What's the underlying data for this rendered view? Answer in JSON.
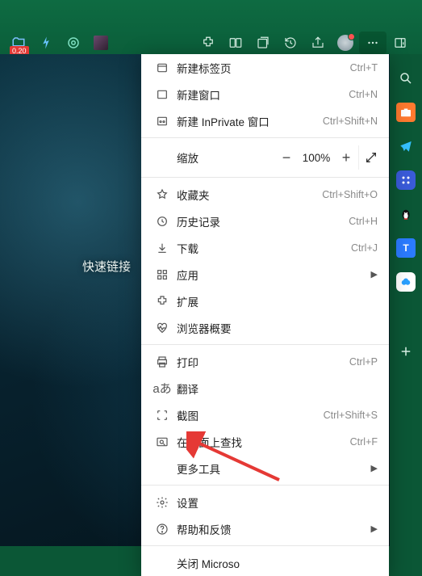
{
  "toolbar": {
    "badge": "0.20"
  },
  "content": {
    "quick_links": "快速链接"
  },
  "menu": {
    "new_tab": {
      "label": "新建标签页",
      "shortcut": "Ctrl+T"
    },
    "new_window": {
      "label": "新建窗口",
      "shortcut": "Ctrl+N"
    },
    "new_inprivate": {
      "label": "新建 InPrivate 窗口",
      "shortcut": "Ctrl+Shift+N"
    },
    "zoom": {
      "label": "缩放",
      "percent": "100%"
    },
    "favorites": {
      "label": "收藏夹",
      "shortcut": "Ctrl+Shift+O"
    },
    "history": {
      "label": "历史记录",
      "shortcut": "Ctrl+H"
    },
    "downloads": {
      "label": "下载",
      "shortcut": "Ctrl+J"
    },
    "apps": {
      "label": "应用"
    },
    "extensions": {
      "label": "扩展"
    },
    "browser_essentials": {
      "label": "浏览器概要"
    },
    "print": {
      "label": "打印",
      "shortcut": "Ctrl+P"
    },
    "translate": {
      "label": "翻译"
    },
    "screenshot": {
      "label": "截图",
      "shortcut": "Ctrl+Shift+S"
    },
    "find": {
      "label": "在页面上查找",
      "shortcut": "Ctrl+F"
    },
    "more_tools": {
      "label": "更多工具"
    },
    "settings": {
      "label": "设置"
    },
    "help": {
      "label": "帮助和反馈"
    },
    "close": {
      "label": "关闭 Microso"
    }
  }
}
